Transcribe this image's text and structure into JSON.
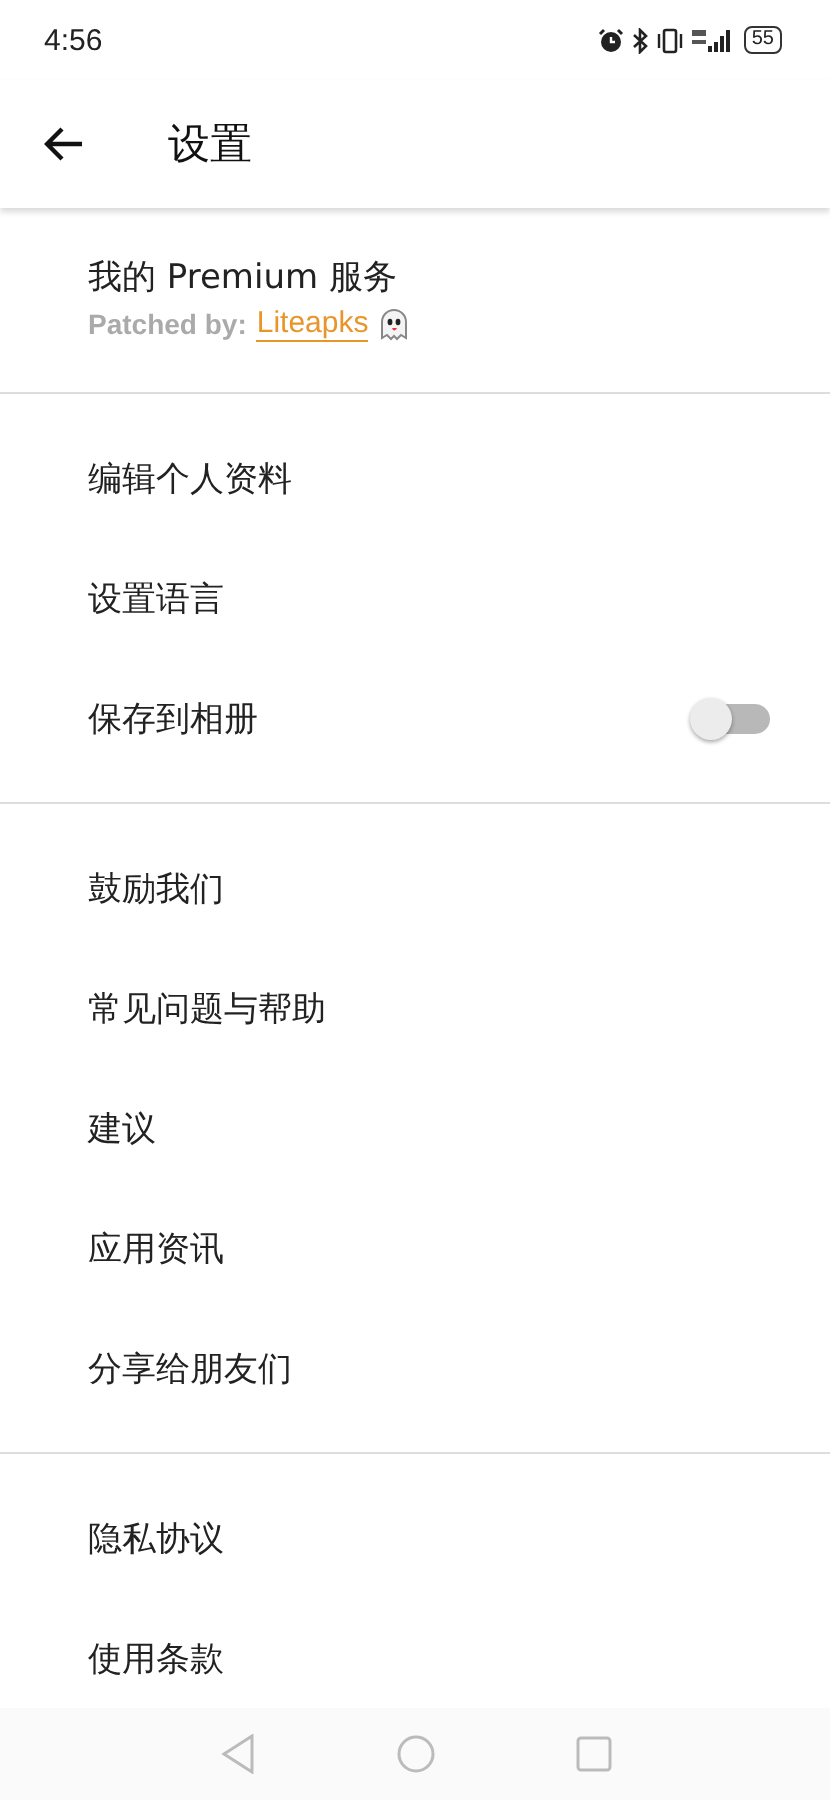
{
  "status_bar": {
    "time": "4:56",
    "battery": "55"
  },
  "toolbar": {
    "title": "设置"
  },
  "sections": [
    {
      "items": [
        {
          "kind": "premium",
          "label": "我的 Premium 服务",
          "subtitle_prefix": "Patched by:",
          "link": "Liteapks"
        }
      ]
    },
    {
      "items": [
        {
          "kind": "plain",
          "label": "编辑个人资料"
        },
        {
          "kind": "plain",
          "label": "设置语言"
        },
        {
          "kind": "toggle",
          "label": "保存到相册",
          "on": false
        }
      ]
    },
    {
      "items": [
        {
          "kind": "plain",
          "label": "鼓励我们"
        },
        {
          "kind": "plain",
          "label": "常见问题与帮助"
        },
        {
          "kind": "plain",
          "label": "建议"
        },
        {
          "kind": "plain",
          "label": "应用资讯"
        },
        {
          "kind": "plain",
          "label": "分享给朋友们"
        }
      ]
    },
    {
      "items": [
        {
          "kind": "plain",
          "label": "隐私协议"
        },
        {
          "kind": "plain",
          "label": "使用条款"
        }
      ]
    }
  ]
}
